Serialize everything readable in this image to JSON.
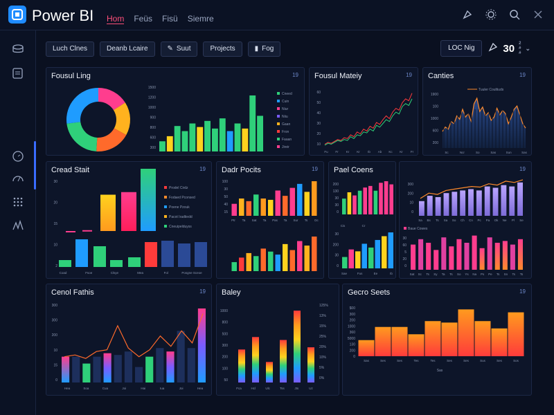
{
  "app": {
    "title": "Power BI"
  },
  "nav": {
    "items": [
      "Hom",
      "Feüs",
      "Fisü",
      "Siemre"
    ],
    "active_index": 0
  },
  "top_icons": [
    "share-icon",
    "gear-icon",
    "search-icon",
    "close-icon"
  ],
  "sidebar": {
    "icons": [
      "database-icon",
      "report-icon",
      "clock-icon",
      "gauge-icon",
      "grid-icon",
      "signal-icon"
    ]
  },
  "toolbar": {
    "buttons": [
      "Luch Clnes",
      "Deanb Lcaire",
      "Suut",
      "Projects",
      "Fog"
    ],
    "location": "LOC Nig",
    "kpi_value": "30",
    "kpi_sub": [
      "2",
      "#",
      "#"
    ]
  },
  "panels": [
    {
      "title": "Fousul Ling",
      "badge": "19",
      "chart_data": [
        {
          "type": "pie",
          "title": "",
          "slices": [
            {
              "label": "",
              "value": 16,
              "color": "#ff3d8e"
            },
            {
              "label": "",
              "value": 17,
              "color": "#ffb21e"
            },
            {
              "label": "",
              "value": 18,
              "color": "#ff6a2b"
            },
            {
              "label": "",
              "value": 22,
              "color": "#2fd07a"
            },
            {
              "label": "",
              "value": 27,
              "color": "#1f9cff"
            }
          ]
        },
        {
          "type": "bar",
          "categories": [
            "",
            "",
            "",
            "",
            "",
            "",
            "",
            "",
            "",
            "",
            "",
            "",
            "",
            ""
          ],
          "values": [
            20,
            30,
            50,
            40,
            55,
            48,
            60,
            45,
            65,
            40,
            55,
            45,
            110,
            70
          ],
          "colors": [
            "#2fd07a",
            "#ffd21e",
            "#2fd07a",
            "#2fd07a",
            "#2fd07a",
            "#ffd21e",
            "#2fd07a",
            "#2fd07a",
            "#2fd07a",
            "#1f9cff",
            "#2fd07a",
            "#ffd21e",
            "#2fd07a",
            "#2fd07a"
          ],
          "ytick_labels": [
            "1500",
            "1200",
            "1000",
            "900",
            "800",
            "600",
            "300"
          ],
          "legend": [
            "Cneed",
            "Cuin",
            "Niur",
            "Niiu",
            "Gaan",
            "Fron",
            "Faaan",
            "Jireir"
          ]
        }
      ]
    },
    {
      "title": "Fousul Mateiy",
      "badge": "19",
      "chart_data": {
        "type": "line",
        "ytick_labels": [
          "60",
          "50",
          "40",
          "30",
          "20",
          "10"
        ],
        "xtick_labels": [
          "Fu",
          "Fr",
          "Kr",
          "Kr",
          "Ib",
          "Ab",
          "Kc",
          "Kr",
          "Fr"
        ],
        "series": [
          {
            "name": "",
            "color": "#ff3b3b",
            "values": [
              4,
              6,
              5,
              7,
              9,
              8,
              11,
              10,
              14,
              12,
              17,
              15,
              20,
              18,
              23,
              21,
              27,
              25,
              30,
              34,
              31,
              38,
              42,
              40,
              48,
              52,
              50,
              58
            ]
          },
          {
            "name": "",
            "color": "#2fd07a",
            "values": [
              3,
              5,
              4,
              6,
              8,
              7,
              9,
              8,
              12,
              10,
              14,
              13,
              17,
              16,
              20,
              18,
              24,
              22,
              26,
              30,
              28,
              34,
              38,
              36,
              44,
              47,
              45,
              52
            ]
          }
        ]
      }
    },
    {
      "title": "Canties",
      "badge": "19",
      "chart_data": {
        "type": "area",
        "legend": [
          "Tuuler Coultiuds"
        ],
        "ytick_labels": [
          "1900",
          "100",
          "1000",
          "600",
          "200"
        ],
        "xtick_labels": [
          "Sc",
          "Ncr",
          "So",
          "Sas",
          "Sun",
          "Sas"
        ],
        "values": [
          30,
          38,
          34,
          48,
          44,
          58,
          52,
          70,
          56,
          62,
          48,
          80,
          90,
          66,
          74,
          58,
          64,
          50,
          56,
          72,
          60,
          68,
          62,
          44,
          56,
          70,
          76,
          60,
          44,
          36
        ]
      }
    },
    {
      "title": "Cread Stait",
      "badge": "19",
      "chart_data": {
        "type": "bar",
        "ytick_labels": [
          "30",
          "20",
          "15",
          "10",
          "2"
        ],
        "xtick_labels": [
          "Coad",
          "Fsoe",
          "Clsye",
          "Mea",
          "Fol",
          "Posgne Sceoe"
        ],
        "series": [
          {
            "name": "top",
            "values": [
              0,
              0,
              1,
              1,
              42,
              45,
              72
            ]
          },
          {
            "name": "bottom",
            "values": [
              10,
              40,
              30,
              10,
              14,
              36,
              38,
              34,
              36
            ]
          }
        ],
        "legend": [
          "Prodel Cirdz",
          "Fodaed Pconsed",
          "Poene Pzouk",
          "Pacot Iradtiedd",
          "Cneuipelduyss"
        ]
      }
    },
    {
      "title": "Dadr Pocits",
      "badge": "19",
      "chart_data": {
        "type": "bar",
        "ytick_labels": [
          "100",
          "30",
          "50",
          "40",
          "15"
        ],
        "xtick_labels": [
          "Ptr",
          "Ta",
          "Sat",
          "Ta",
          "Pas",
          "Ta",
          "Sur",
          "Ts",
          "Dc"
        ],
        "series": [
          {
            "name": "top",
            "values": [
              18,
              26,
              22,
              32,
              26,
              24,
              38,
              30,
              42,
              48,
              36,
              52
            ]
          },
          {
            "name": "bottom",
            "values": [
              12,
              18,
              24,
              20,
              30,
              26,
              22,
              36,
              28,
              40,
              34,
              46
            ]
          }
        ]
      }
    },
    {
      "title": "Pael Coens",
      "badge": "19",
      "chart_data": [
        {
          "type": "bar",
          "ytick_labels": [
            "200",
            "130",
            "30",
            "30",
            "0"
          ],
          "values": [
            20,
            28,
            24,
            30,
            34,
            36,
            30,
            40,
            42,
            38
          ],
          "xtick_labels": [
            "Cis",
            "Cr"
          ]
        },
        {
          "type": "bar",
          "ytick_labels": [
            "30",
            "200",
            "30",
            "0"
          ],
          "values": [
            12,
            20,
            18,
            26,
            22,
            30,
            34,
            38
          ],
          "xtick_labels": [
            "Sae",
            "Fus",
            "Ee",
            "Ib"
          ]
        }
      ]
    },
    {
      "title": "",
      "badge": "19",
      "chart_data": [
        {
          "type": "bar",
          "ytick_labels": [
            "300",
            "200",
            "10",
            "0"
          ],
          "values": [
            22,
            30,
            28,
            34,
            36,
            38,
            40,
            38,
            44,
            42,
            46,
            44,
            50
          ],
          "line": [
            26,
            34,
            32,
            38,
            40,
            42,
            44,
            43,
            48,
            46,
            52,
            50,
            54
          ],
          "xtick_labels": [
            "Sa",
            "Bs",
            "Ts",
            "Sa",
            "So",
            "Ch",
            "Cn",
            "Pc",
            "Pa",
            "Ok",
            "Ne",
            "Pl",
            "Se"
          ]
        },
        {
          "type": "bar",
          "legend": [
            "Baue Cowes"
          ],
          "ytick_labels": [
            "30",
            "60",
            "5",
            "20",
            "0"
          ],
          "values": [
            28,
            34,
            30,
            22,
            36,
            26,
            34,
            30,
            38,
            24,
            36,
            30,
            32,
            28,
            34
          ],
          "xtick_labels": [
            "Sat",
            "Sc",
            "Ts",
            "Sy",
            "Ta",
            "Ts",
            "So",
            "Ys",
            "Na",
            "Ps",
            "Pe",
            "Ts",
            "Sn",
            "Ts",
            "Ts"
          ]
        }
      ]
    },
    {
      "title": "Cenol Fathis",
      "badge": "19",
      "chart_data": {
        "type": "bar",
        "ytick_labels": [
          "300",
          "300",
          "200",
          "10",
          "15",
          "0"
        ],
        "xtick_labels": [
          "Hea",
          "Soa",
          "Cua",
          "Joi",
          "Hai",
          "Iua",
          "Joi",
          "Hea"
        ],
        "values": [
          30,
          30,
          22,
          30,
          34,
          32,
          36,
          18,
          30,
          40,
          36,
          60,
          40,
          86
        ],
        "line": [
          30,
          32,
          28,
          36,
          38,
          66,
          40,
          30,
          38,
          54,
          42,
          60,
          46,
          80
        ]
      }
    },
    {
      "title": "Baley",
      "badge": "",
      "chart_data": {
        "type": "bar",
        "ytick_labels": [
          "1000",
          "800",
          "500",
          "300",
          "200",
          "100",
          "50"
        ],
        "ytick_labels_right": [
          "125%",
          "13%",
          "15%",
          "25%",
          "20%",
          "10%",
          "5%",
          "0%"
        ],
        "xtick_labels": [
          "Fca",
          "Hcl",
          "Ulc",
          "Tss",
          "Jts",
          "Uz"
        ],
        "values": [
          45,
          62,
          28,
          58,
          98,
          48
        ]
      }
    },
    {
      "title": "Gecro Seets",
      "badge": "19",
      "chart_data": {
        "type": "bar",
        "xlabel": "Sas",
        "ytick_labels": [
          "$00",
          "300",
          "200",
          "1000",
          "360",
          "5000",
          "130",
          "200",
          "0"
        ],
        "xtick_labels": [
          "Sas",
          "Ses",
          "Ses",
          "Tes",
          "Tes",
          "Ses",
          "Ses",
          "Sus",
          "Ses",
          "Sos"
        ],
        "values": [
          22,
          40,
          40,
          30,
          48,
          46,
          64,
          48,
          38,
          60
        ]
      }
    }
  ]
}
